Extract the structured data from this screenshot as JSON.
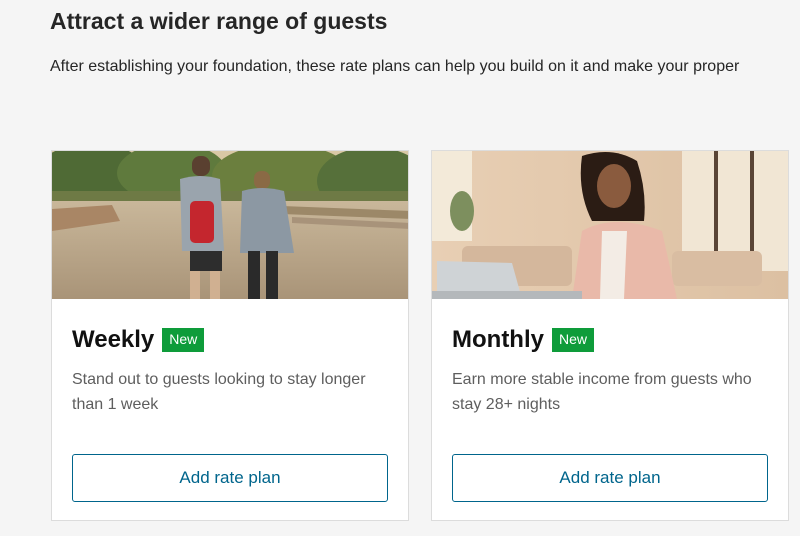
{
  "section": {
    "title": "Attract a wider range of guests",
    "subtitle": "After establishing your foundation, these rate plans can help you build on it and make your proper"
  },
  "cards": [
    {
      "title": "Weekly",
      "badge": "New",
      "description": "Stand out to guests looking to stay longer than 1 week",
      "button_label": "Add rate plan",
      "image": "couple-walking-in-park-photo"
    },
    {
      "title": "Monthly",
      "badge": "New",
      "description": "Earn more stable income from guests who stay 28+ nights",
      "button_label": "Add rate plan",
      "image": "woman-working-on-laptop-photo"
    }
  ],
  "colors": {
    "badge_green": "#0e9c3a",
    "button_blue": "#00658c",
    "background": "#f5f5f5"
  }
}
